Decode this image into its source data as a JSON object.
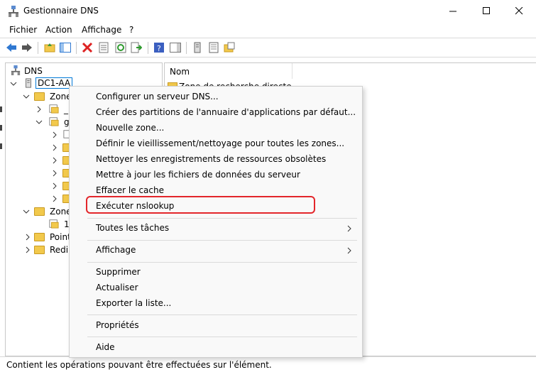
{
  "window": {
    "title": "Gestionnaire DNS"
  },
  "menubar": {
    "items": [
      "Fichier",
      "Action",
      "Affichage",
      "?"
    ]
  },
  "tree": {
    "root": "DNS",
    "server": "DC1-AA",
    "rows": [
      "Zone",
      "_",
      "g",
      "Zone",
      "1",
      "Point",
      "Redi"
    ]
  },
  "list": {
    "column_name": "Nom",
    "first_item": "Zone de recherche directe"
  },
  "context_menu": {
    "items": [
      "Configurer un serveur DNS...",
      "Créer des partitions de l'annuaire d'applications par défaut...",
      "Nouvelle zone...",
      "Définir le vieillissement/nettoyage pour toutes les zones...",
      "Nettoyer les enregistrements de ressources obsolètes",
      "Mettre à jour les fichiers de données du serveur",
      "Effacer le cache",
      "Exécuter nslookup",
      "Toutes les tâches",
      "Affichage",
      "Supprimer",
      "Actualiser",
      "Exporter la liste...",
      "Propriétés",
      "Aide"
    ],
    "highlighted": "Exécuter nslookup"
  },
  "statusbar": {
    "text": "Contient les opérations pouvant être effectuées sur l'élément."
  },
  "colors": {
    "highlight_border": "#e3262b",
    "folder": "#f2c94c",
    "selection_border": "#0078d7"
  }
}
